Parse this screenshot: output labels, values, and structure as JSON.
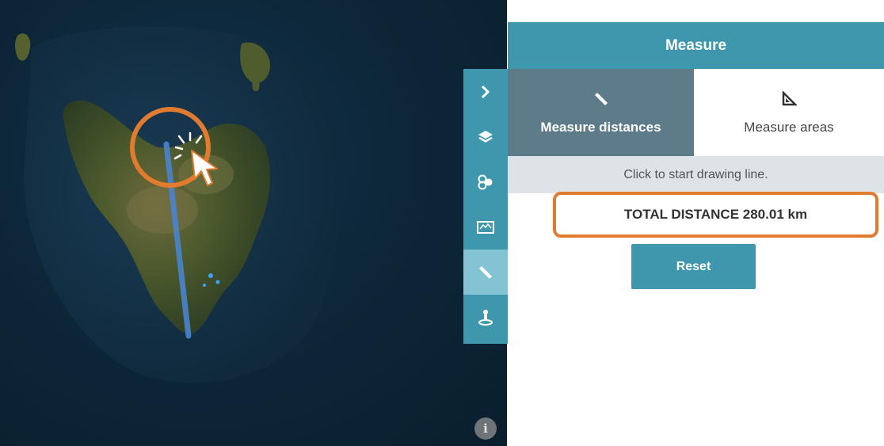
{
  "map": {
    "highlight_color": "#e17b2f",
    "measure_line_color": "#4a84d0",
    "info_icon_glyph": "i"
  },
  "toolbar": {
    "items": [
      {
        "name": "expand",
        "icon": "chevron-right-icon"
      },
      {
        "name": "layers",
        "icon": "layers-icon"
      },
      {
        "name": "analysis",
        "icon": "overlay-tool-icon"
      },
      {
        "name": "basemap",
        "icon": "map-icon"
      },
      {
        "name": "measure",
        "icon": "ruler-icon",
        "active": true
      },
      {
        "name": "locate",
        "icon": "pin-person-icon"
      }
    ]
  },
  "panel": {
    "title": "Measure",
    "tabs": {
      "distances": "Measure distances",
      "areas": "Measure areas"
    },
    "hint": "Click to start drawing line.",
    "result": "TOTAL DISTANCE 280.01 km",
    "reset_label": "Reset"
  },
  "colors": {
    "accent": "#3e97ad",
    "active_tab": "#5d7b89",
    "highlight": "#e17b2f"
  }
}
